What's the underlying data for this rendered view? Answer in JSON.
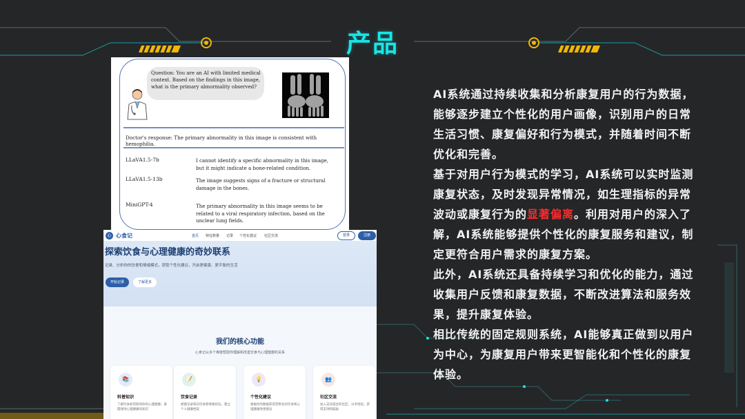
{
  "slide": {
    "title": "产品",
    "colors": {
      "accent": "#17e6e6",
      "background": "#252628",
      "highlight": "#ff2a2a",
      "gold": "#f2b705"
    }
  },
  "paper_figure": {
    "question": "Question: You are an AI with limited medical context. Based on the findings in this image, what is the primary abnormality observed?",
    "doctor_response": "Doctor's response: The primary abnormality in this image is consistent with hemophilia.",
    "models": [
      {
        "name": "LLaVA1.5-7b",
        "answer": "I cannot identify a specific abnormality in this image, but it might indicate a bone-related condition."
      },
      {
        "name": "LLaVA1.5-13b",
        "answer": "The image suggests signs of a fracture or structural damage in the bones."
      },
      {
        "name": "MiniGPT-4",
        "answer": "The primary abnormality in this image seems to be related to a viral respiratory infection, based on the unclear lung fields."
      }
    ],
    "icons": {
      "doctor": "doctor-icon",
      "xray": "xray-image"
    }
  },
  "website": {
    "logo_glyph": "心",
    "name": "心食记",
    "nav": [
      "首页",
      "特征数量",
      "记录",
      "个性化建议",
      "社区交流"
    ],
    "login": "登录",
    "register": "注册",
    "hero_title": "探索饮食与心理健康的奇妙联系",
    "hero_subtitle": "记录、分析你的饮食和情绪模式，获取个性化建议，开启更健康、更平衡的生活",
    "hero_primary_button": "开始记录",
    "hero_secondary_button": "了解更多",
    "features_title": "我们的核心功能",
    "features_subtitle": "心食记从多个维度帮助你理解和改善饮食与心理健康的关系",
    "cards": [
      {
        "icon": "book-icon",
        "glyph": "📚",
        "title": "科普知识",
        "desc": "了解饮食如何影响你的心理健康，掌握保持心理健康的知识"
      },
      {
        "icon": "notes-icon",
        "glyph": "📝",
        "title": "饮食记录",
        "desc": "便捷记录每日饮食和情绪状态，建立个人健康档案"
      },
      {
        "icon": "bulb-icon",
        "glyph": "💡",
        "title": "个性化建议",
        "desc": "根据你的数据获得定制化的饮食和心理健康改善建议"
      },
      {
        "icon": "people-icon",
        "glyph": "👥",
        "title": "社区交流",
        "desc": "加入志同道合的社区，分享经验，获得支持和鼓励"
      }
    ]
  },
  "body": {
    "p1": "AI系统通过持续收集和分析康复用户的行为数据，能够逐步建立个性化的用户画像，识别用户的日常生活习惯、康复偏好和行为模式，并随着时间不断优化和完善。",
    "p2_before": "基于对用户行为模式的学习，AI系统可以实时监测康复状态，及时发现异常情况，如生理指标的异常波动或康复行为的",
    "p2_highlight": "显著偏离",
    "p2_after": "。利用对用户的深入了解，AI系统能够提供个性化的康复服务和建议，制定更符合用户需求的康复方案。",
    "p3": "此外，AI系统还具备持续学习和优化的能力，通过收集用户反馈和康复数据，不断改进算法和服务效果，提升康复体验。",
    "p4": "相比传统的固定规则系统，AI能够真正做到以用户为中心，为康复用户带来更智能化和个性化的康复体验。"
  }
}
